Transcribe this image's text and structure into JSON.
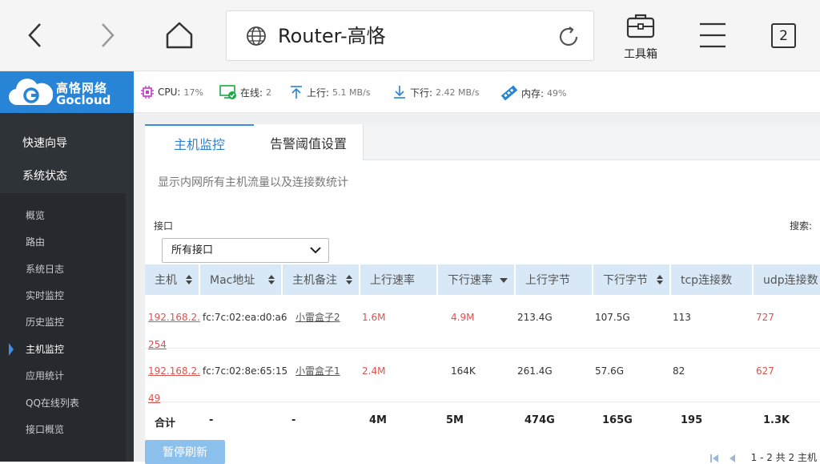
{
  "browser": {
    "url_text": "Router-高恪",
    "toolbox_label": "工具箱",
    "tab_count": "2"
  },
  "logo": {
    "cn": "高恪网络",
    "en": "Gocloud"
  },
  "status": {
    "cpu_label": "CPU:",
    "cpu_value": "17%",
    "online_label": "在线:",
    "online_value": "2",
    "up_label": "上行:",
    "up_value": "5.1 MB/s",
    "down_label": "下行:",
    "down_value": "2.42 MB/s",
    "mem_label": "内存:",
    "mem_value": "49%"
  },
  "sidebar": {
    "top": [
      "快速向导",
      "系统状态"
    ],
    "sub": [
      "概览",
      "路由",
      "系统日志",
      "实时监控",
      "历史监控",
      "主机监控",
      "应用统计",
      "QQ在线列表",
      "接口概览"
    ],
    "active": "主机监控"
  },
  "tabs": [
    "主机监控",
    "告警阈值设置"
  ],
  "desc": "显示内网所有主机流量以及连接数统计",
  "filter": {
    "interface_label": "接口",
    "interface_value": "所有接口",
    "search_label": "搜索:"
  },
  "table": {
    "headers": [
      "主机",
      "Mac地址",
      "主机备注",
      "上行速率",
      "下行速率",
      "上行字节",
      "下行字节",
      "tcp连接数",
      "udp连接数"
    ],
    "rows": [
      {
        "host": "192.168.2.254",
        "host_a": "192.168.2.",
        "host_b": "254",
        "mac": "fc:7c:02:ea:d0:a6",
        "note": "小雷盒子2",
        "up": "1.6M",
        "down": "4.9M",
        "upb": "213.4G",
        "downb": "107.5G",
        "tcp": "113",
        "udp": "727"
      },
      {
        "host": "192.168.2.49",
        "host_a": "192.168.2.",
        "host_b": "49",
        "mac": "fc:7c:02:8e:65:15",
        "note": "小雷盒子1",
        "up": "2.4M",
        "down": "164K",
        "upb": "261.4G",
        "downb": "57.6G",
        "tcp": "82",
        "udp": "627"
      }
    ],
    "total": {
      "label": "合计",
      "mac": "-",
      "note": "-",
      "up": "4M",
      "down": "5M",
      "upb": "474G",
      "downb": "165G",
      "tcp": "195",
      "udp": "1.3K"
    }
  },
  "pause_button": "暂停刷新",
  "pager": "1 - 2 共 2 主机",
  "colors": {
    "accent": "#2784d6",
    "header_bg": "#d8e8f7",
    "sidebar": "#2e3338",
    "alert": "#d9534f"
  }
}
